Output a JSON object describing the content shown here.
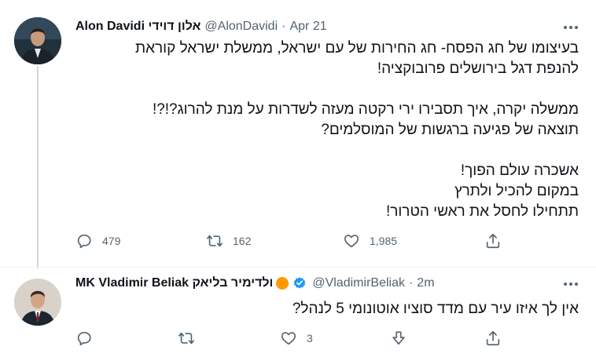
{
  "colors": {
    "text": "#0f1419",
    "muted": "#536471",
    "verified": "#1d9bf0",
    "thread_line": "#cfd9de",
    "emoji_badge": "#ff9900"
  },
  "tweets": [
    {
      "display_name": "Alon Davidi אלון דוידי",
      "handle": "@AlonDavidi",
      "separator": "·",
      "time": "Apr 21",
      "verified": false,
      "lines": [
        "בעיצומו של חג הפסח- חג החירות של עם ישראל, ממשלת ישראל קוראת",
        "להנפת דגל בירושלים פרובוקציה!",
        "",
        "ממשלה יקרה, איך תסבירו ירי רקטה מעזה לשדרות על מנת להרוג?!?!",
        "תוצאה של פגיעה  ברגשות של המוסלמים?",
        "",
        "אשכרה עולם הפוך!",
        "במקום להכיל ולתרץ",
        "תתחילו לחסל את ראשי הטרור!"
      ],
      "actions": {
        "reply_count": "479",
        "retweet_count": "162",
        "like_count": "1,985"
      },
      "icons": [
        "more-icon",
        "reply-icon",
        "retweet-icon",
        "heart-icon",
        "share-icon"
      ]
    },
    {
      "display_name": "MK Vladimir Beliak ולדימיר בליאק",
      "handle": "@VladimirBeliak",
      "separator": "·",
      "time": "2m",
      "verified": true,
      "lines": [
        "אין לך איזו עיר עם מדד סוציו אוטונומי 5 לנהל?"
      ],
      "actions": {
        "like_count": "3"
      },
      "icons": [
        "more-icon",
        "reply-icon",
        "retweet-icon",
        "heart-icon",
        "downvote-icon",
        "share-icon"
      ]
    }
  ]
}
